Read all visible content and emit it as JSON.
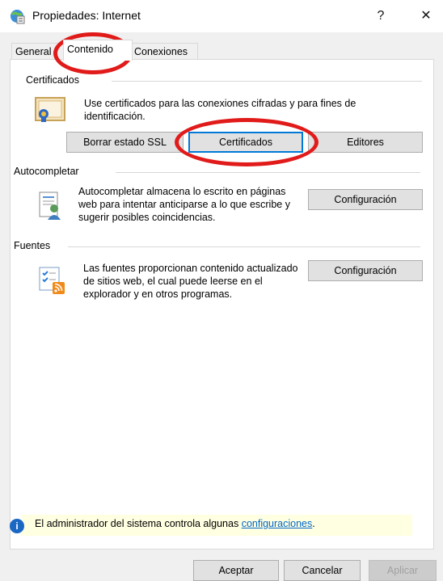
{
  "window": {
    "title": "Propiedades: Internet",
    "help": "?",
    "close": "✕"
  },
  "tabs": [
    {
      "label": "General"
    },
    {
      "label": "Contenido"
    },
    {
      "label": "Conexiones"
    }
  ],
  "certificates": {
    "label": "Certificados",
    "description": "Use certificados para las conexiones cifradas y para fines de identificación.",
    "buttons": {
      "clear_ssl": "Borrar estado SSL",
      "certificates": "Certificados",
      "publishers": "Editores"
    }
  },
  "autocomplete": {
    "label": "Autocompletar",
    "description": "Autocompletar almacena lo escrito en páginas web para intentar anticiparse a lo que escribe y sugerir posibles coincidencias.",
    "settings_button": "Configuración"
  },
  "feeds": {
    "label": "Fuentes",
    "description": "Las fuentes proporcionan contenido actualizado de sitios web, el cual puede leerse en el explorador y en otros programas.",
    "settings_button": "Configuración"
  },
  "info": {
    "text": "El administrador del sistema controla algunas",
    "link": "configuraciones",
    "suffix": "."
  },
  "footer": {
    "ok": "Aceptar",
    "cancel": "Cancelar",
    "apply": "Aplicar"
  },
  "colors": {
    "annotation": "#e11a1a",
    "focus": "#0078d7",
    "info_bg": "#ffffe1"
  }
}
